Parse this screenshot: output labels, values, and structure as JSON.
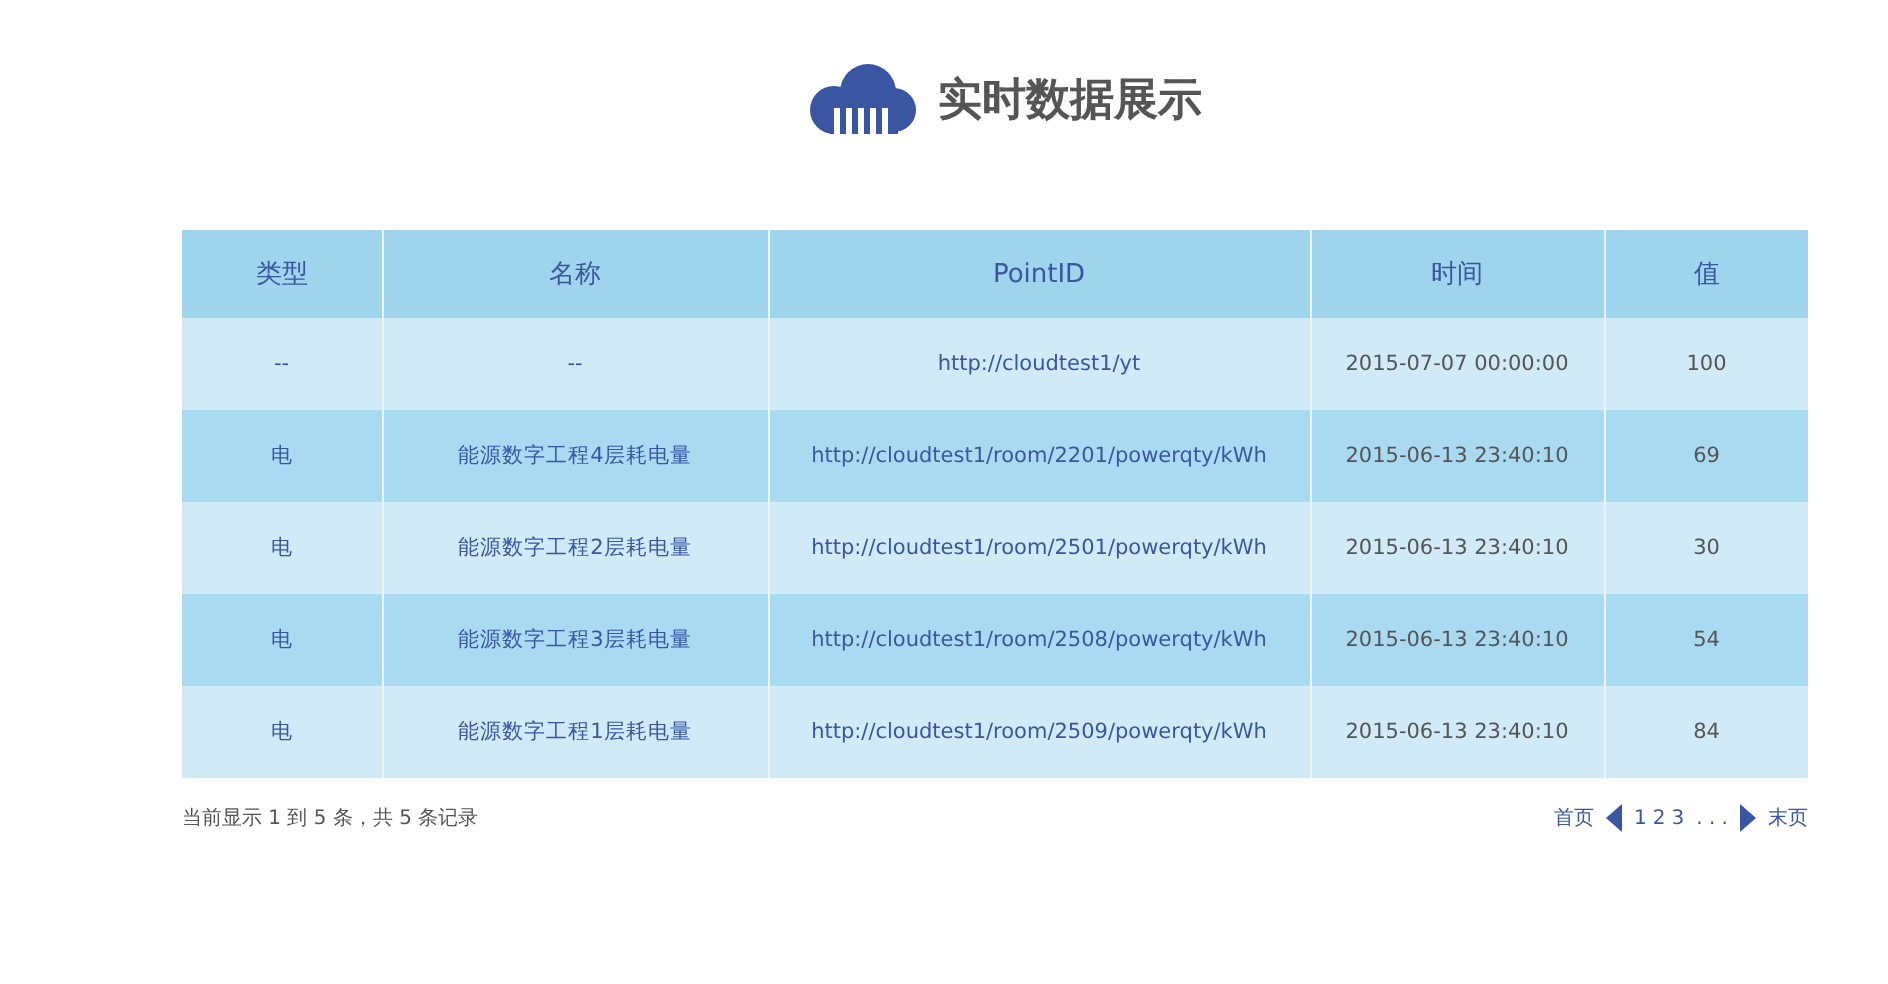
{
  "header": {
    "title": "实时数据展示"
  },
  "table": {
    "columns": [
      "类型",
      "名称",
      "PointID",
      "时间",
      "值"
    ],
    "rows": [
      {
        "cells": [
          "--",
          "--",
          "http://cloudtest1/yt",
          "2015-07-07 00:00:00",
          "100"
        ]
      },
      {
        "cells": [
          "电",
          "能源数字工程4层耗电量",
          "http://cloudtest1/room/2201/powerqty/kWh",
          "2015-06-13 23:40:10",
          "69"
        ]
      },
      {
        "cells": [
          "电",
          "能源数字工程2层耗电量",
          "http://cloudtest1/room/2501/powerqty/kWh",
          "2015-06-13 23:40:10",
          "30"
        ]
      },
      {
        "cells": [
          "电",
          "能源数字工程3层耗电量",
          "http://cloudtest1/room/2508/powerqty/kWh",
          "2015-06-13 23:40:10",
          "54"
        ]
      },
      {
        "cells": [
          "电",
          "能源数字工程1层耗电量",
          "http://cloudtest1/room/2509/powerqty/kWh",
          "2015-06-13 23:40:10",
          "84"
        ]
      }
    ]
  },
  "footer": {
    "summary": "当前显示 1 到 5 条，共 5 条记录",
    "pagination": {
      "first": "首页",
      "pages": [
        "1",
        "2",
        "3"
      ],
      "ellipsis": ". . .",
      "last": "末页"
    }
  }
}
